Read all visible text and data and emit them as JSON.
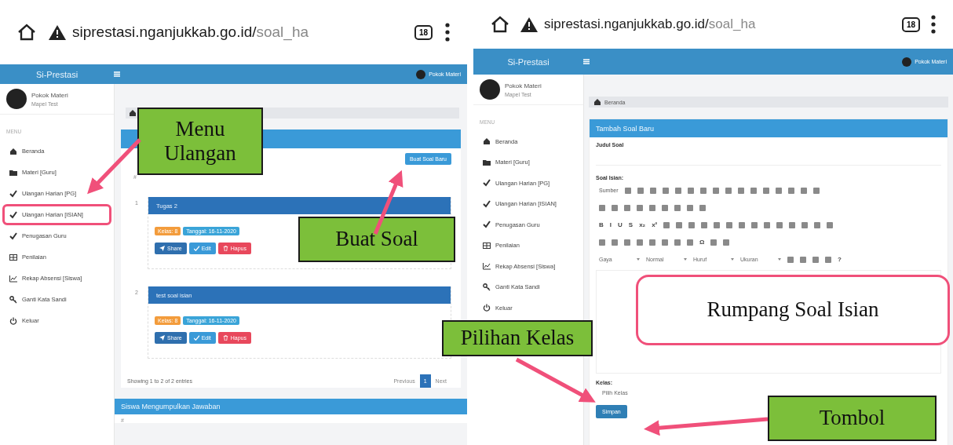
{
  "left": {
    "browser": {
      "url_host": "siprestasi.nganjukkab.go.id/",
      "url_path": "soal_ha",
      "tab_count": "18"
    },
    "app": {
      "brand": "Si-Prestasi",
      "header_user": "Pokok Materi",
      "user_name": "Pokok Materi",
      "user_role": "Mapel Test",
      "menu_label": "MENU",
      "nav": [
        {
          "kind": "home",
          "label": "Beranda",
          "highlighted": false
        },
        {
          "kind": "folder",
          "label": "Materi [Guru]",
          "highlighted": false
        },
        {
          "kind": "check",
          "label": "Ulangan Harian [PG]",
          "highlighted": false
        },
        {
          "kind": "check",
          "label": "Ulangan Harian [ISIAN]",
          "highlighted": true
        },
        {
          "kind": "check",
          "label": "Penugasan Guru",
          "highlighted": false
        },
        {
          "kind": "table",
          "label": "Penilaian",
          "highlighted": false
        },
        {
          "kind": "chart",
          "label": "Rekap Absensi [Siswa]",
          "highlighted": false
        },
        {
          "kind": "key",
          "label": "Ganti Kata Sandi",
          "highlighted": false
        },
        {
          "kind": "power",
          "label": "Keluar",
          "highlighted": false
        }
      ],
      "create_button": "Buat Soal Baru",
      "column_header": "#",
      "items": [
        {
          "number": "1",
          "title": "Tugas 2",
          "badges": [
            {
              "kind": "class",
              "text": "Kelas: 8"
            },
            {
              "kind": "date",
              "text": "Tanggal: 16-11-2020"
            }
          ],
          "actions": [
            {
              "kind": "share",
              "text": "Share"
            },
            {
              "kind": "edit",
              "text": "Edit"
            },
            {
              "kind": "delete",
              "text": "Hapus"
            }
          ]
        },
        {
          "number": "2",
          "title": "test soal isian",
          "badges": [
            {
              "kind": "class",
              "text": "Kelas: 8"
            },
            {
              "kind": "date",
              "text": "Tanggal: 16-11-2020"
            }
          ],
          "actions": [
            {
              "kind": "share",
              "text": "Share"
            },
            {
              "kind": "edit",
              "text": "Edit"
            },
            {
              "kind": "delete",
              "text": "Hapus"
            }
          ]
        }
      ],
      "footer": {
        "info": "Showing 1 to 2 of 2 entries",
        "previous": "Previous",
        "pages": [
          {
            "label": "1",
            "selected": true
          }
        ],
        "next": "Next"
      },
      "section_title": "Siswa Mengumpulkan Jawaban",
      "section_column_header": "#"
    }
  },
  "right": {
    "browser": {
      "url_host": "siprestasi.nganjukkab.go.id/",
      "url_path": "soal_ha",
      "tab_count": "18"
    },
    "app": {
      "brand": "Si-Prestasi",
      "header_user": "Pokok Materi",
      "user_name": "Pokok Materi",
      "user_role": "Mapel Test",
      "menu_label": "MENU",
      "nav": [
        {
          "kind": "home",
          "label": "Beranda",
          "highlighted": false
        },
        {
          "kind": "folder",
          "label": "Materi [Guru]",
          "highlighted": false
        },
        {
          "kind": "check",
          "label": "Ulangan Harian [PG]",
          "highlighted": false
        },
        {
          "kind": "check",
          "label": "Ulangan Harian [ISIAN]",
          "highlighted": false
        },
        {
          "kind": "check",
          "label": "Penugasan Guru",
          "highlighted": false
        },
        {
          "kind": "table",
          "label": "Penilaian",
          "highlighted": false
        },
        {
          "kind": "chart",
          "label": "Rekap Absensi [Siswa]",
          "highlighted": false
        },
        {
          "kind": "key",
          "label": "Ganti Kata Sandi",
          "highlighted": false
        },
        {
          "kind": "power",
          "label": "Keluar",
          "highlighted": false
        }
      ],
      "breadcrumb": "Beranda",
      "panel_title": "Tambah Soal Baru",
      "title_label": "Judul Soal",
      "question_label": "Soal Isian:",
      "toolbar": [
        [
          {
            "kind": "text",
            "text": "Sumber"
          },
          {
            "kind": "icon"
          },
          {
            "kind": "icon"
          },
          {
            "kind": "icon"
          },
          {
            "kind": "icon"
          },
          {
            "kind": "icon"
          },
          {
            "kind": "icon"
          },
          {
            "kind": "icon"
          },
          {
            "kind": "icon"
          },
          {
            "kind": "icon"
          },
          {
            "kind": "icon"
          },
          {
            "kind": "icon"
          },
          {
            "kind": "icon"
          },
          {
            "kind": "icon"
          },
          {
            "kind": "icon"
          },
          {
            "kind": "icon"
          },
          {
            "kind": "icon"
          }
        ],
        [
          {
            "kind": "icon"
          },
          {
            "kind": "icon"
          },
          {
            "kind": "icon"
          },
          {
            "kind": "icon"
          },
          {
            "kind": "icon"
          },
          {
            "kind": "icon"
          },
          {
            "kind": "icon"
          },
          {
            "kind": "icon"
          },
          {
            "kind": "icon"
          }
        ],
        [
          {
            "kind": "text",
            "text": "B"
          },
          {
            "kind": "text",
            "text": "I"
          },
          {
            "kind": "text",
            "text": "U"
          },
          {
            "kind": "text",
            "text": "S"
          },
          {
            "kind": "text",
            "text": "x₂"
          },
          {
            "kind": "text",
            "text": "x²"
          },
          {
            "kind": "icon"
          },
          {
            "kind": "icon"
          },
          {
            "kind": "icon"
          },
          {
            "kind": "icon"
          },
          {
            "kind": "icon"
          },
          {
            "kind": "icon"
          },
          {
            "kind": "icon"
          },
          {
            "kind": "icon"
          },
          {
            "kind": "icon"
          },
          {
            "kind": "icon"
          },
          {
            "kind": "icon"
          },
          {
            "kind": "icon"
          },
          {
            "kind": "icon"
          },
          {
            "kind": "icon"
          }
        ],
        [
          {
            "kind": "icon"
          },
          {
            "kind": "icon"
          },
          {
            "kind": "icon"
          },
          {
            "kind": "icon"
          },
          {
            "kind": "icon"
          },
          {
            "kind": "icon"
          },
          {
            "kind": "icon"
          },
          {
            "kind": "icon"
          },
          {
            "kind": "text",
            "text": "Ω"
          },
          {
            "kind": "icon"
          },
          {
            "kind": "icon"
          }
        ],
        [
          {
            "kind": "dropdown",
            "text": "Gaya"
          },
          {
            "kind": "dropdown",
            "text": "Normal"
          },
          {
            "kind": "dropdown",
            "text": "Huruf"
          },
          {
            "kind": "dropdown",
            "text": "Ukuran"
          },
          {
            "kind": "icon"
          },
          {
            "kind": "icon"
          },
          {
            "kind": "icon"
          },
          {
            "kind": "icon"
          },
          {
            "kind": "text",
            "text": "?"
          }
        ]
      ],
      "class_label": "Kelas:",
      "class_placeholder": "Pilih Kelas",
      "save_button": "Simpan"
    }
  },
  "annotations": [
    {
      "kind": "callout",
      "text": "Menu Ulangan"
    },
    {
      "kind": "callout",
      "text": "Buat Soal"
    },
    {
      "kind": "outline",
      "text": "Rumpang Soal Isian"
    },
    {
      "kind": "callout",
      "text": "Pilihan Kelas"
    },
    {
      "kind": "callout",
      "text": "Tombol"
    }
  ]
}
